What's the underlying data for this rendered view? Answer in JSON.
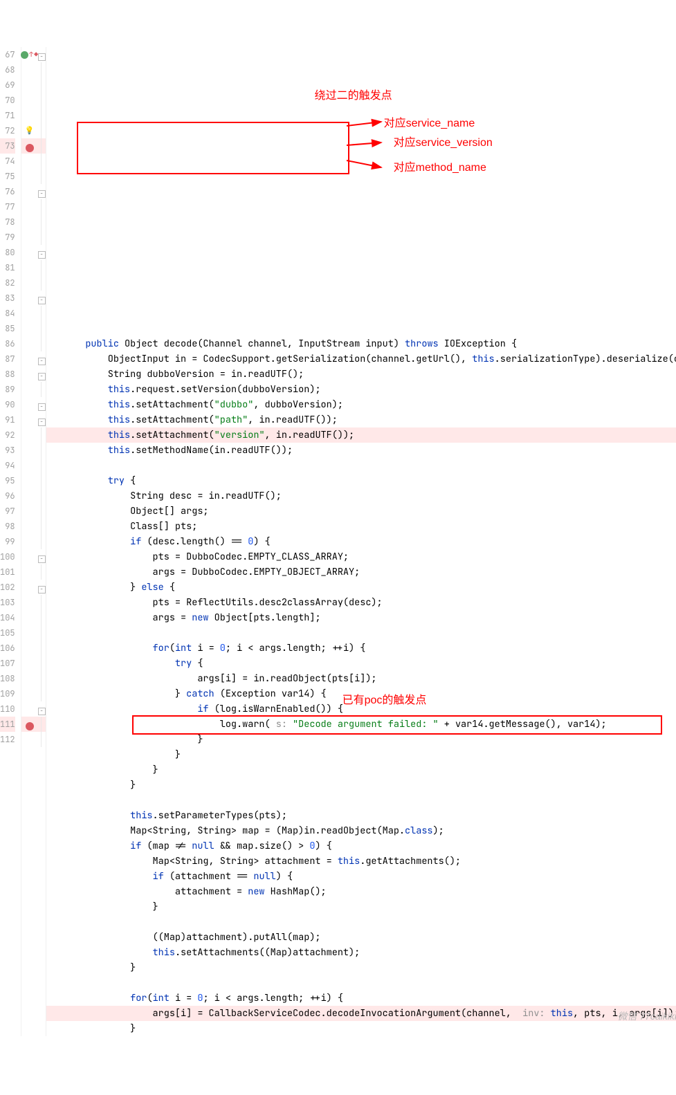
{
  "lines": [
    {
      "num": 67,
      "marker": "green-arrow",
      "fold": "minus",
      "bp": false,
      "code": [
        {
          "t": "    ",
          "c": ""
        },
        {
          "t": "public",
          "c": "kw"
        },
        {
          "t": " Object decode(Channel channel, InputStream input) ",
          "c": ""
        },
        {
          "t": "throws",
          "c": "kw"
        },
        {
          "t": " IOException {",
          "c": ""
        }
      ]
    },
    {
      "num": 68,
      "marker": "",
      "fold": "line",
      "bp": false,
      "code": [
        {
          "t": "        ObjectInput in = CodecSupport.getSerialization(channel.getUrl(), ",
          "c": ""
        },
        {
          "t": "this",
          "c": "kw"
        },
        {
          "t": ".serializationType).deserialize(ch",
          "c": ""
        }
      ]
    },
    {
      "num": 69,
      "marker": "",
      "fold": "line",
      "bp": false,
      "code": [
        {
          "t": "        String dubboVersion = in.readUTF();",
          "c": ""
        }
      ]
    },
    {
      "num": 70,
      "marker": "",
      "fold": "line",
      "bp": false,
      "code": [
        {
          "t": "        ",
          "c": ""
        },
        {
          "t": "this",
          "c": "kw"
        },
        {
          "t": ".request.setVersion(dubboVersion);",
          "c": ""
        }
      ]
    },
    {
      "num": 71,
      "marker": "",
      "fold": "line",
      "bp": false,
      "code": [
        {
          "t": "        ",
          "c": ""
        },
        {
          "t": "this",
          "c": "kw"
        },
        {
          "t": ".setAttachment(",
          "c": ""
        },
        {
          "t": "\"dubbo\"",
          "c": "str"
        },
        {
          "t": ", dubboVersion);",
          "c": ""
        }
      ]
    },
    {
      "num": 72,
      "marker": "bulb",
      "fold": "line",
      "bp": false,
      "code": [
        {
          "t": "        ",
          "c": ""
        },
        {
          "t": "this",
          "c": "kw"
        },
        {
          "t": ".setAttachment(",
          "c": ""
        },
        {
          "t": "\"path\"",
          "c": "str"
        },
        {
          "t": ", in.readUTF());",
          "c": ""
        }
      ]
    },
    {
      "num": 73,
      "marker": "breakpoint",
      "fold": "line",
      "bp": true,
      "code": [
        {
          "t": "        ",
          "c": ""
        },
        {
          "t": "this",
          "c": "kw"
        },
        {
          "t": ".setAttachment(",
          "c": ""
        },
        {
          "t": "\"version\"",
          "c": "str"
        },
        {
          "t": ", in.readUTF());",
          "c": ""
        }
      ]
    },
    {
      "num": 74,
      "marker": "",
      "fold": "line",
      "bp": false,
      "code": [
        {
          "t": "        ",
          "c": ""
        },
        {
          "t": "this",
          "c": "kw"
        },
        {
          "t": ".setMethodName(in.readUTF());",
          "c": ""
        }
      ]
    },
    {
      "num": 75,
      "marker": "",
      "fold": "line",
      "bp": false,
      "code": [
        {
          "t": "",
          "c": ""
        }
      ]
    },
    {
      "num": 76,
      "marker": "",
      "fold": "minus",
      "bp": false,
      "code": [
        {
          "t": "        ",
          "c": ""
        },
        {
          "t": "try",
          "c": "kw"
        },
        {
          "t": " {",
          "c": ""
        }
      ]
    },
    {
      "num": 77,
      "marker": "",
      "fold": "line",
      "bp": false,
      "code": [
        {
          "t": "            String desc = in.readUTF();",
          "c": ""
        }
      ]
    },
    {
      "num": 78,
      "marker": "",
      "fold": "line",
      "bp": false,
      "code": [
        {
          "t": "            Object[] args;",
          "c": ""
        }
      ]
    },
    {
      "num": 79,
      "marker": "",
      "fold": "line",
      "bp": false,
      "code": [
        {
          "t": "            Class[] pts;",
          "c": ""
        }
      ]
    },
    {
      "num": 80,
      "marker": "",
      "fold": "minus",
      "bp": false,
      "code": [
        {
          "t": "            ",
          "c": ""
        },
        {
          "t": "if",
          "c": "kw"
        },
        {
          "t": " (desc.length() == ",
          "c": ""
        },
        {
          "t": "0",
          "c": "num"
        },
        {
          "t": ") {",
          "c": ""
        }
      ]
    },
    {
      "num": 81,
      "marker": "",
      "fold": "line",
      "bp": false,
      "code": [
        {
          "t": "                pts = DubboCodec.EMPTY_CLASS_ARRAY;",
          "c": ""
        }
      ]
    },
    {
      "num": 82,
      "marker": "",
      "fold": "line",
      "bp": false,
      "code": [
        {
          "t": "                args = DubboCodec.EMPTY_OBJECT_ARRAY;",
          "c": ""
        }
      ]
    },
    {
      "num": 83,
      "marker": "",
      "fold": "minus",
      "bp": false,
      "code": [
        {
          "t": "            } ",
          "c": ""
        },
        {
          "t": "else",
          "c": "kw"
        },
        {
          "t": " {",
          "c": ""
        }
      ]
    },
    {
      "num": 84,
      "marker": "",
      "fold": "line",
      "bp": false,
      "code": [
        {
          "t": "                pts = ReflectUtils.desc2classArray(desc);",
          "c": ""
        }
      ]
    },
    {
      "num": 85,
      "marker": "",
      "fold": "line",
      "bp": false,
      "code": [
        {
          "t": "                args = ",
          "c": ""
        },
        {
          "t": "new",
          "c": "kw"
        },
        {
          "t": " Object[pts.length];",
          "c": ""
        }
      ]
    },
    {
      "num": 86,
      "marker": "",
      "fold": "line",
      "bp": false,
      "code": [
        {
          "t": "",
          "c": ""
        }
      ]
    },
    {
      "num": 87,
      "marker": "",
      "fold": "minus",
      "bp": false,
      "code": [
        {
          "t": "                ",
          "c": ""
        },
        {
          "t": "for",
          "c": "kw"
        },
        {
          "t": "(",
          "c": ""
        },
        {
          "t": "int",
          "c": "kw"
        },
        {
          "t": " i = ",
          "c": ""
        },
        {
          "t": "0",
          "c": "num"
        },
        {
          "t": "; i < args.length; ++i) {",
          "c": ""
        }
      ]
    },
    {
      "num": 88,
      "marker": "",
      "fold": "minus",
      "bp": false,
      "code": [
        {
          "t": "                    ",
          "c": ""
        },
        {
          "t": "try",
          "c": "kw"
        },
        {
          "t": " {",
          "c": ""
        }
      ]
    },
    {
      "num": 89,
      "marker": "",
      "fold": "line",
      "bp": false,
      "code": [
        {
          "t": "                        args[i] = in.readObject(pts[i]);",
          "c": ""
        }
      ]
    },
    {
      "num": 90,
      "marker": "",
      "fold": "minus",
      "bp": false,
      "code": [
        {
          "t": "                    } ",
          "c": ""
        },
        {
          "t": "catch",
          "c": "kw"
        },
        {
          "t": " (Exception var14) {",
          "c": ""
        }
      ]
    },
    {
      "num": 91,
      "marker": "",
      "fold": "minus",
      "bp": false,
      "code": [
        {
          "t": "                        ",
          "c": ""
        },
        {
          "t": "if",
          "c": "kw"
        },
        {
          "t": " (log.isWarnEnabled()) {",
          "c": ""
        }
      ]
    },
    {
      "num": 92,
      "marker": "",
      "fold": "line",
      "bp": false,
      "code": [
        {
          "t": "                            log.warn( ",
          "c": ""
        },
        {
          "t": "s:",
          "c": "hint"
        },
        {
          "t": " ",
          "c": ""
        },
        {
          "t": "\"Decode argument failed: \"",
          "c": "str"
        },
        {
          "t": " + var14.getMessage(), var14);",
          "c": ""
        }
      ]
    },
    {
      "num": 93,
      "marker": "",
      "fold": "line",
      "bp": false,
      "code": [
        {
          "t": "                        }",
          "c": ""
        }
      ]
    },
    {
      "num": 94,
      "marker": "",
      "fold": "line",
      "bp": false,
      "code": [
        {
          "t": "                    }",
          "c": ""
        }
      ]
    },
    {
      "num": 95,
      "marker": "",
      "fold": "line",
      "bp": false,
      "code": [
        {
          "t": "                }",
          "c": ""
        }
      ]
    },
    {
      "num": 96,
      "marker": "",
      "fold": "line",
      "bp": false,
      "code": [
        {
          "t": "            }",
          "c": ""
        }
      ]
    },
    {
      "num": 97,
      "marker": "",
      "fold": "line",
      "bp": false,
      "code": [
        {
          "t": "",
          "c": ""
        }
      ]
    },
    {
      "num": 98,
      "marker": "",
      "fold": "line",
      "bp": false,
      "code": [
        {
          "t": "            ",
          "c": ""
        },
        {
          "t": "this",
          "c": "kw"
        },
        {
          "t": ".setParameterTypes(pts);",
          "c": ""
        }
      ]
    },
    {
      "num": 99,
      "marker": "",
      "fold": "line",
      "bp": false,
      "code": [
        {
          "t": "            Map<String, String> map = (Map)in.readObject(Map.",
          "c": ""
        },
        {
          "t": "class",
          "c": "kw"
        },
        {
          "t": ");",
          "c": ""
        }
      ]
    },
    {
      "num": 100,
      "marker": "",
      "fold": "minus",
      "bp": false,
      "code": [
        {
          "t": "            ",
          "c": ""
        },
        {
          "t": "if",
          "c": "kw"
        },
        {
          "t": " (map != ",
          "c": ""
        },
        {
          "t": "null",
          "c": "kw"
        },
        {
          "t": " && map.size() > ",
          "c": ""
        },
        {
          "t": "0",
          "c": "num"
        },
        {
          "t": ") {",
          "c": ""
        }
      ]
    },
    {
      "num": 101,
      "marker": "",
      "fold": "line",
      "bp": false,
      "code": [
        {
          "t": "                Map<String, String> attachment = ",
          "c": ""
        },
        {
          "t": "this",
          "c": "kw"
        },
        {
          "t": ".getAttachments();",
          "c": ""
        }
      ]
    },
    {
      "num": 102,
      "marker": "",
      "fold": "minus",
      "bp": false,
      "code": [
        {
          "t": "                ",
          "c": ""
        },
        {
          "t": "if",
          "c": "kw"
        },
        {
          "t": " (attachment == ",
          "c": ""
        },
        {
          "t": "null",
          "c": "kw"
        },
        {
          "t": ") {",
          "c": ""
        }
      ]
    },
    {
      "num": 103,
      "marker": "",
      "fold": "line",
      "bp": false,
      "code": [
        {
          "t": "                    attachment = ",
          "c": ""
        },
        {
          "t": "new",
          "c": "kw"
        },
        {
          "t": " HashMap();",
          "c": ""
        }
      ]
    },
    {
      "num": 104,
      "marker": "",
      "fold": "line",
      "bp": false,
      "code": [
        {
          "t": "                }",
          "c": ""
        }
      ]
    },
    {
      "num": 105,
      "marker": "",
      "fold": "line",
      "bp": false,
      "code": [
        {
          "t": "",
          "c": ""
        }
      ]
    },
    {
      "num": 106,
      "marker": "",
      "fold": "line",
      "bp": false,
      "code": [
        {
          "t": "                ((Map)attachment).putAll(map);",
          "c": ""
        }
      ]
    },
    {
      "num": 107,
      "marker": "",
      "fold": "line",
      "bp": false,
      "code": [
        {
          "t": "                ",
          "c": ""
        },
        {
          "t": "this",
          "c": "kw"
        },
        {
          "t": ".setAttachments((Map)attachment);",
          "c": ""
        }
      ]
    },
    {
      "num": 108,
      "marker": "",
      "fold": "line",
      "bp": false,
      "code": [
        {
          "t": "            }",
          "c": ""
        }
      ]
    },
    {
      "num": 109,
      "marker": "",
      "fold": "line",
      "bp": false,
      "code": [
        {
          "t": "",
          "c": ""
        }
      ]
    },
    {
      "num": 110,
      "marker": "",
      "fold": "minus",
      "bp": false,
      "code": [
        {
          "t": "            ",
          "c": ""
        },
        {
          "t": "for",
          "c": "kw"
        },
        {
          "t": "(",
          "c": ""
        },
        {
          "t": "int",
          "c": "kw"
        },
        {
          "t": " i = ",
          "c": ""
        },
        {
          "t": "0",
          "c": "num"
        },
        {
          "t": "; i < args.length; ++i) {",
          "c": ""
        }
      ]
    },
    {
      "num": 111,
      "marker": "breakpoint",
      "fold": "line",
      "bp": true,
      "code": [
        {
          "t": "                args[i] = CallbackServiceCodec.decodeInvocationArgument(channel,  ",
          "c": ""
        },
        {
          "t": "inv:",
          "c": "hint"
        },
        {
          "t": " ",
          "c": ""
        },
        {
          "t": "this",
          "c": "kw"
        },
        {
          "t": ", pts, i, args[i]);",
          "c": ""
        }
      ]
    },
    {
      "num": 112,
      "marker": "",
      "fold": "line",
      "bp": false,
      "code": [
        {
          "t": "            }",
          "c": ""
        }
      ]
    }
  ],
  "annotations": {
    "top_heading": "绕过二的触发点",
    "arrow1": "对应service_name",
    "arrow2": "对应service_version",
    "arrow3": "对应method_name",
    "bottom_heading": "已有poc的触发点"
  },
  "watermark": "微信 77caikiki"
}
